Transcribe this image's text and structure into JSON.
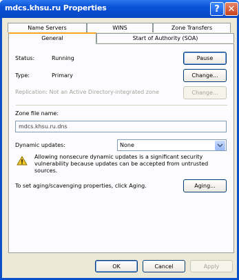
{
  "window": {
    "title": "mdcs.khsu.ru Properties"
  },
  "titlebar": {
    "help_glyph": "?",
    "close_glyph": "✕"
  },
  "tabs": {
    "row1": [
      "Name Servers",
      "WINS",
      "Zone Transfers"
    ],
    "row2": [
      "General",
      "Start of Authority (SOA)"
    ],
    "active": "General"
  },
  "general": {
    "status_label": "Status:",
    "status_value": "Running",
    "pause_button": "Pause",
    "type_label": "Type:",
    "type_value": "Primary",
    "change_type_button": "Change...",
    "replication_text": "Replication:  Not an Active Directory-integrated zone",
    "change_replication_button": "Change...",
    "zone_file_label": "Zone file name:",
    "zone_file_value": "mdcs.khsu.ru.dns",
    "dynamic_updates_label": "Dynamic updates:",
    "dynamic_updates_value": "None",
    "warning_text": "Allowing nonsecure dynamic updates is a significant security vulnerability because updates can be accepted from untrusted sources.",
    "aging_text": "To set aging/scavenging properties, click Aging.",
    "aging_button": "Aging..."
  },
  "footer": {
    "ok": "OK",
    "cancel": "Cancel",
    "apply": "Apply"
  },
  "colors": {
    "title_blue": "#0a52d6",
    "client_bg": "#ece9d8",
    "warning_yellow": "#f2c830"
  }
}
